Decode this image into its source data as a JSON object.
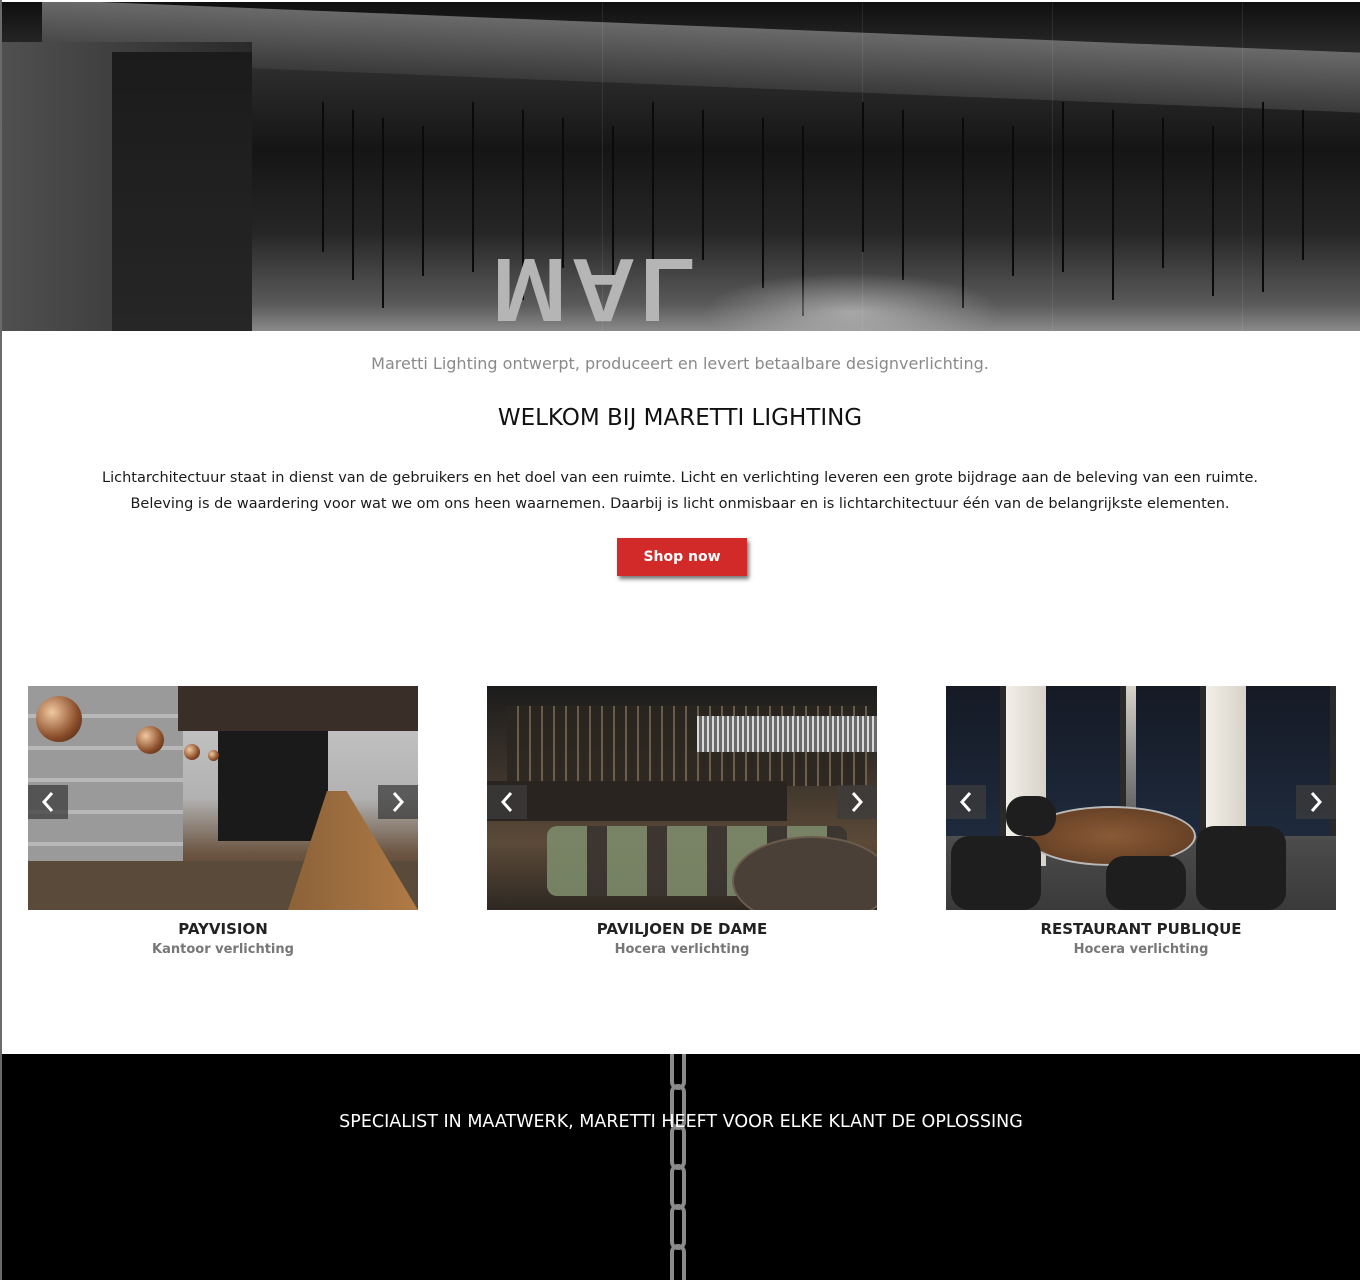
{
  "hero": {
    "reflected_sign": "MAL"
  },
  "intro": {
    "tagline": "Maretti Lighting ontwerpt, produceert en levert betaalbare designverlichting.",
    "heading": "WELKOM BIJ MARETTI LIGHTING",
    "body_line1": "Lichtarchitectuur staat in dienst van de gebruikers en het doel van een ruimte. Licht en verlichting leveren een grote bijdrage aan de beleving van een ruimte.",
    "body_line2": "Beleving is de waardering voor wat we om ons heen waarnemen. Daarbij is licht onmisbaar en is lichtarchitectuur één van de belangrijkste elementen.",
    "cta_label": "Shop now"
  },
  "projects": [
    {
      "title": "PAYVISION",
      "subtitle": "Kantoor verlichting"
    },
    {
      "title": "PAVILJOEN DE DAME",
      "subtitle": "Hocera verlichting"
    },
    {
      "title": "RESTAURANT PUBLIQUE",
      "subtitle": "Hocera verlichting"
    }
  ],
  "carousel_icons": {
    "prev": "chevron-left-icon",
    "next": "chevron-right-icon"
  },
  "banner": {
    "text": "SPECIALIST IN MAATWERK, MARETTI HEEFT VOOR ELKE KLANT DE OPLOSSING"
  },
  "colors": {
    "accent": "#d22a28",
    "banner_bg": "#000000",
    "tagline": "#8a8a8a"
  }
}
